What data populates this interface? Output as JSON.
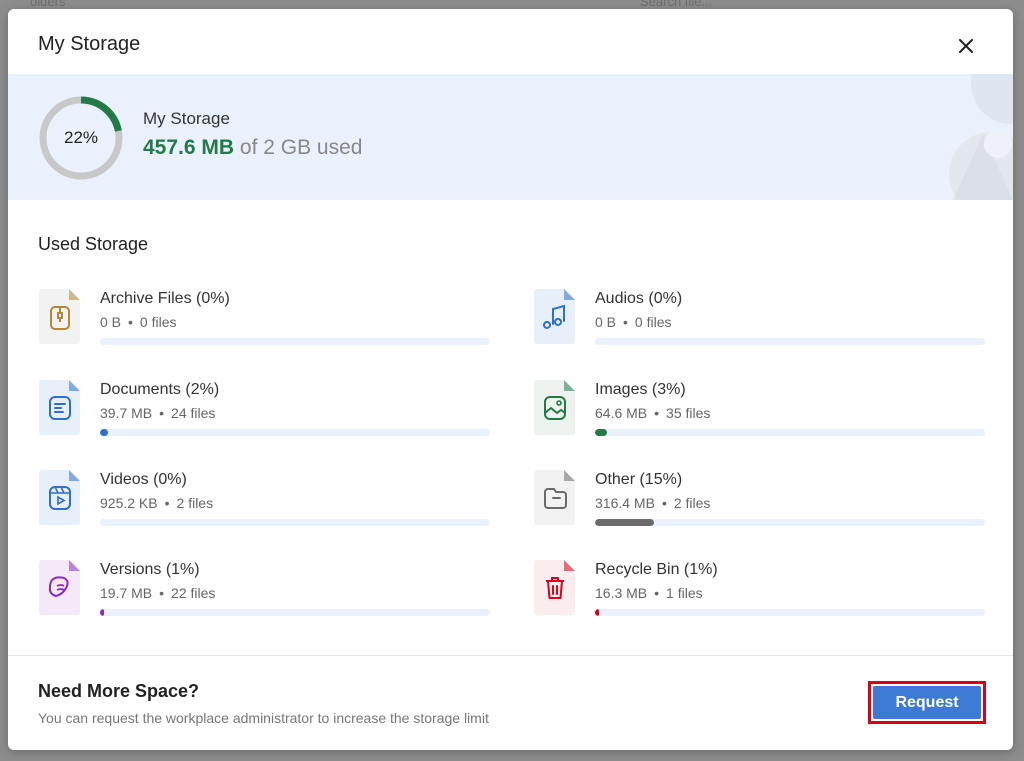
{
  "background": {
    "top_left": "olders",
    "search_placeholder": "Search file..."
  },
  "modal": {
    "title": "My Storage",
    "close_label": "×"
  },
  "storage": {
    "percent_label": "22%",
    "percent_value": 22,
    "title": "My Storage",
    "used": "457.6 MB",
    "total_text": "of 2 GB used",
    "ring_color": "#237a48",
    "ring_track_color": "#c8c8c8"
  },
  "used_storage": {
    "title": "Used Storage",
    "categories": [
      {
        "id": "archive",
        "name": "Archive Files (0%)",
        "size": "0 B",
        "files": "0 files",
        "percent": 0,
        "icon": "archive-zip-icon",
        "color": "#b08a3a",
        "tint": "#f2f2f2"
      },
      {
        "id": "audios",
        "name": "Audios (0%)",
        "size": "0 B",
        "files": "0 files",
        "percent": 0,
        "icon": "music-note-icon",
        "color": "#2f6fd0",
        "tint": "#e7effb"
      },
      {
        "id": "documents",
        "name": "Documents (2%)",
        "size": "39.7 MB",
        "files": "24 files",
        "percent": 2,
        "icon": "document-icon",
        "color": "#2f6fd0",
        "tint": "#e7effb"
      },
      {
        "id": "images",
        "name": "Images (3%)",
        "size": "64.6 MB",
        "files": "35 files",
        "percent": 3,
        "icon": "image-icon",
        "color": "#237a48",
        "tint": "#eef2ef"
      },
      {
        "id": "videos",
        "name": "Videos (0%)",
        "size": "925.2 KB",
        "files": "2 files",
        "percent": 0,
        "icon": "video-icon",
        "color": "#2f6fd0",
        "tint": "#e7effb"
      },
      {
        "id": "other",
        "name": "Other (15%)",
        "size": "316.4 MB",
        "files": "2 files",
        "percent": 15,
        "icon": "folder-icon",
        "color": "#6b6b6b",
        "tint": "#f2f2f2"
      },
      {
        "id": "versions",
        "name": "Versions (1%)",
        "size": "19.7 MB",
        "files": "22 files",
        "percent": 1,
        "icon": "versions-icon",
        "color": "#8a2bc8",
        "tint": "#f3e9f9"
      },
      {
        "id": "recycle",
        "name": "Recycle Bin (1%)",
        "size": "16.3 MB",
        "files": "1 files",
        "percent": 1,
        "icon": "trash-icon",
        "color": "#d9001b",
        "tint": "#fbecee"
      }
    ]
  },
  "footer": {
    "title": "Need More Space?",
    "subtitle": "You can request the workplace administrator to increase the storage limit",
    "request_label": "Request"
  },
  "separator": "•"
}
